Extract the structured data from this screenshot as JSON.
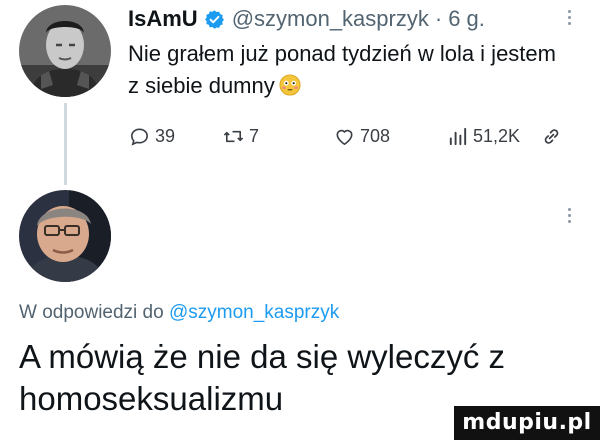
{
  "tweet": {
    "author_name": "IsAmU",
    "author_handle": "@szymon_kasprzyk",
    "separator": "·",
    "time": "6 g.",
    "text": "Nie grałem już ponad tydzień w lola i jestem z siebie dumny",
    "emoji": "flushed-face-emoji",
    "stats": {
      "replies": "39",
      "retweets": "7",
      "likes": "708",
      "views": "51,2K"
    }
  },
  "reply": {
    "replying_to_prefix": "W odpowiedzi do",
    "replying_to_handle": "@szymon_kasprzyk",
    "text": "A mówią że nie da się wyleczyć z homoseksualizmu"
  },
  "icons": [
    "verified-badge-icon",
    "reply-icon",
    "retweet-icon",
    "like-icon",
    "views-icon",
    "share-icon",
    "more-icon"
  ],
  "colors": {
    "verified": "#1d9bf0",
    "mention": "#1d9bf0",
    "secondary_text": "#536471",
    "thread_line": "#cfd9de"
  },
  "watermark": "mdupiu.pl"
}
